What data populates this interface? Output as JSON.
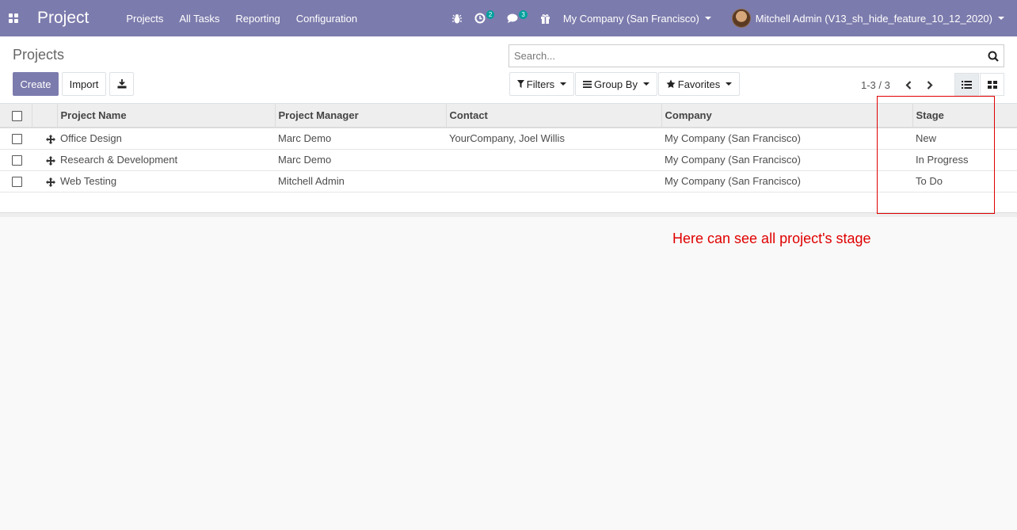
{
  "navbar": {
    "brand": "Project",
    "menu": [
      "Projects",
      "All Tasks",
      "Reporting",
      "Configuration"
    ],
    "activity_count": "2",
    "message_count": "3",
    "company": "My Company (San Francisco)",
    "user": "Mitchell Admin (V13_sh_hide_feature_10_12_2020)",
    "colors": {
      "bar": "#7c7bad",
      "badge": "#00a09d"
    }
  },
  "control_panel": {
    "breadcrumb": "Projects",
    "create_label": "Create",
    "import_label": "Import",
    "search_placeholder": "Search...",
    "filters_label": "Filters",
    "groupby_label": "Group By",
    "favorites_label": "Favorites",
    "pager": "1-3 / 3"
  },
  "table": {
    "columns": [
      "Project Name",
      "Project Manager",
      "Contact",
      "Company",
      "Stage"
    ],
    "rows": [
      {
        "name": "Office Design",
        "manager": "Marc Demo",
        "contact": "YourCompany, Joel Willis",
        "company": "My Company (San Francisco)",
        "stage": "New"
      },
      {
        "name": "Research & Development",
        "manager": "Marc Demo",
        "contact": "",
        "company": "My Company (San Francisco)",
        "stage": "In Progress"
      },
      {
        "name": "Web Testing",
        "manager": "Mitchell Admin",
        "contact": "",
        "company": "My Company (San Francisco)",
        "stage": "To Do"
      }
    ]
  },
  "annotation": {
    "text": "Here can see all project's stage",
    "color": "#e00000"
  }
}
